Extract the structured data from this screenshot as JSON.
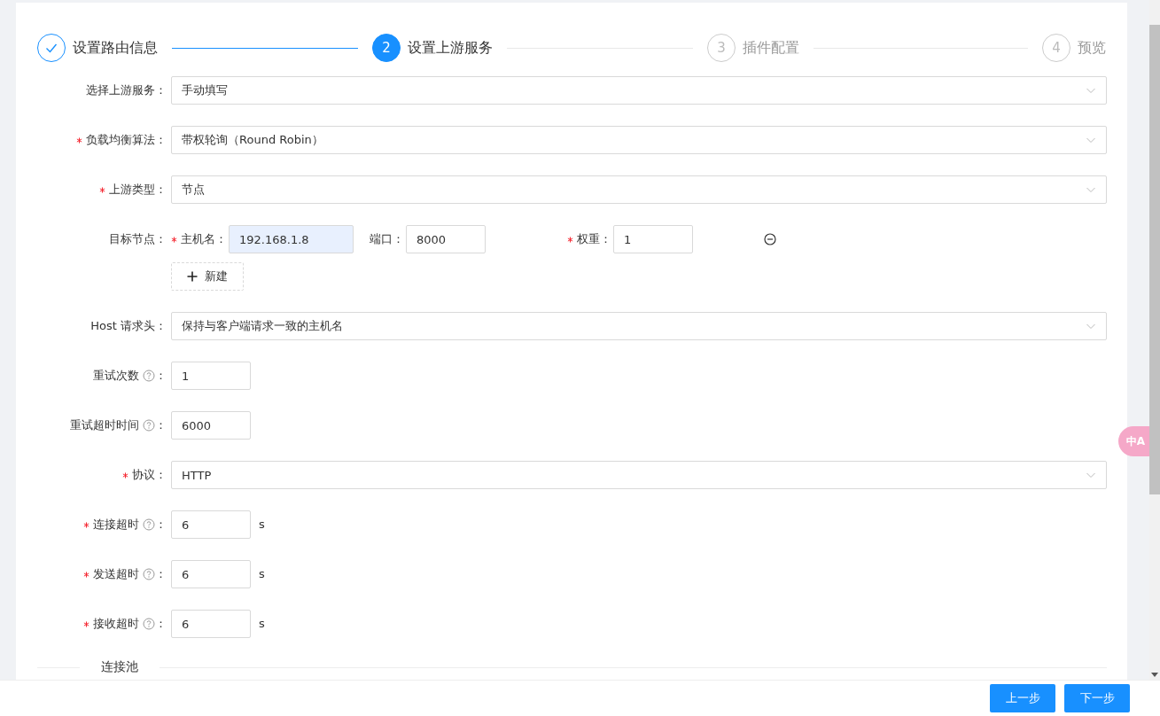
{
  "steps": [
    {
      "title": "设置路由信息",
      "finished": true,
      "selected": false
    },
    {
      "number": "2",
      "title": "设置上游服务",
      "finished": false,
      "selected": true
    },
    {
      "number": "3",
      "title": "插件配置",
      "finished": false,
      "selected": false
    },
    {
      "number": "4",
      "title": "预览",
      "finished": false,
      "selected": false
    }
  ],
  "form": [
    {
      "kind": "select",
      "label": "选择上游服务：",
      "required": false,
      "value": "手动填写"
    },
    {
      "kind": "select",
      "label": "负载均衡算法：",
      "required": true,
      "value": "带权轮询（Round Robin）"
    },
    {
      "kind": "select",
      "label": "上游类型：",
      "required": true,
      "value": "节点"
    },
    {
      "kind": "nodes",
      "label": "目标节点：",
      "required": false,
      "nodes": [
        {
          "host_label": "主机名：",
          "host_required": true,
          "host": "192.168.1.8",
          "host_autofilled": true,
          "port_label": "端口：",
          "port_required": false,
          "port": "8000",
          "weight_label": "权重：",
          "weight_required": true,
          "weight": "1"
        }
      ],
      "add_label": "新建"
    },
    {
      "kind": "select",
      "label": "Host 请求头：",
      "required": false,
      "value": "保持与客户端请求一致的主机名"
    },
    {
      "kind": "input",
      "label": "重试次数",
      "help": true,
      "label_end": "：",
      "required": false,
      "value": "1"
    },
    {
      "kind": "input",
      "label": "重试超时时间",
      "help": true,
      "label_end": "：",
      "required": false,
      "value": "6000"
    },
    {
      "kind": "select",
      "label": "协议：",
      "required": true,
      "value": "HTTP"
    },
    {
      "kind": "input",
      "label": "连接超时",
      "help": true,
      "label_end": "：",
      "required": true,
      "value": "6",
      "suffix": "s"
    },
    {
      "kind": "input",
      "label": "发送超时",
      "help": true,
      "label_end": "：",
      "required": true,
      "value": "6",
      "suffix": "s"
    },
    {
      "kind": "input",
      "label": "接收超时",
      "help": true,
      "label_end": "：",
      "required": true,
      "value": "6",
      "suffix": "s"
    }
  ],
  "divider": "连接池",
  "translate_button": "中A",
  "footer": {
    "buttons": [
      "上一步",
      "下一步"
    ]
  }
}
